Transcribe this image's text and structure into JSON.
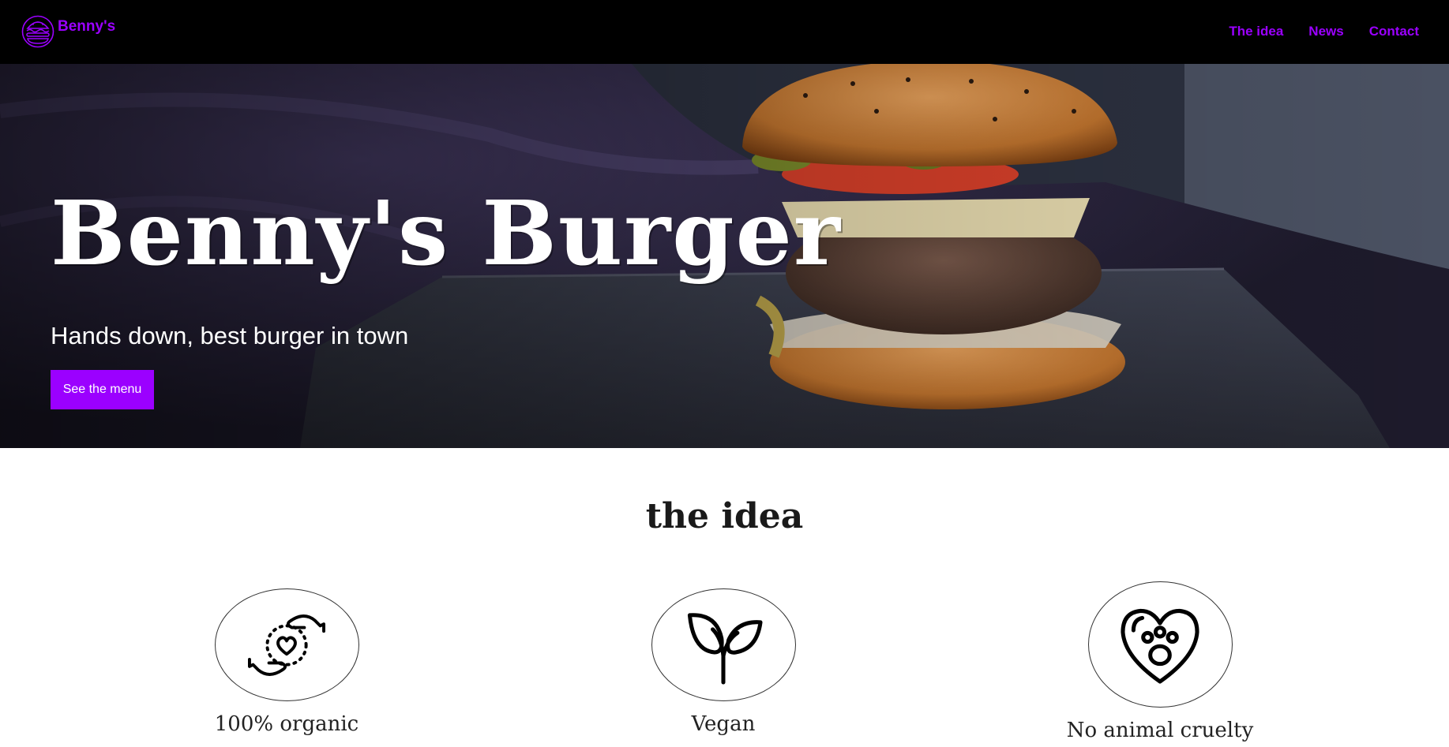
{
  "navbar": {
    "brand": "Benny's",
    "brand_logo": "burger-logo-icon",
    "links": [
      {
        "label": "The idea"
      },
      {
        "label": "News"
      },
      {
        "label": "Contact"
      }
    ]
  },
  "hero": {
    "title": "Benny's Burger",
    "subtitle": "Hands down, best burger in town",
    "cta_label": "See the menu",
    "image": "burger-on-slate-photo"
  },
  "idea": {
    "title": "the idea",
    "features": [
      {
        "label": "100% organic",
        "icon": "hands-heart-icon"
      },
      {
        "label": "Vegan",
        "icon": "sprout-leaf-icon"
      },
      {
        "label": "No animal cruelty",
        "icon": "heart-paw-icon"
      }
    ]
  },
  "colors": {
    "accent": "#9b00ff",
    "navbar_bg": "#000000",
    "page_bg": "#ffffff"
  }
}
